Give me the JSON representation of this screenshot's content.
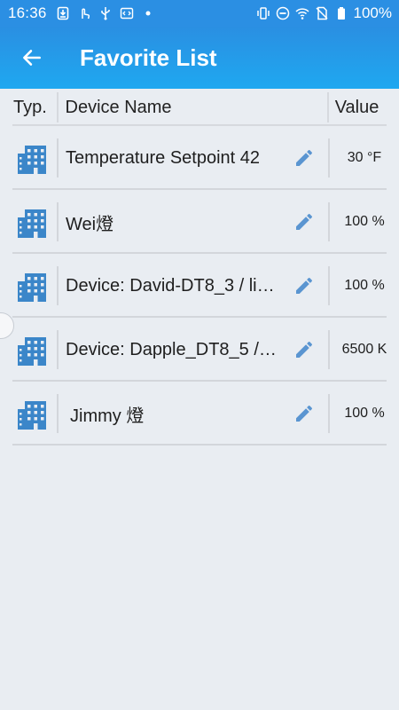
{
  "status_bar": {
    "time": "16:36",
    "battery": "100%",
    "icons_left": [
      "download-icon",
      "touch-icon",
      "usb-icon",
      "code-icon",
      "dot-icon"
    ],
    "icons_right": [
      "vibrate-icon",
      "dnd-icon",
      "wifi-icon",
      "no-sim-icon",
      "battery-icon"
    ]
  },
  "app_bar": {
    "title": "Favorite List",
    "back_icon": "arrow-left-icon"
  },
  "table": {
    "headers": {
      "type": "Typ.",
      "name": "Device Name",
      "value": "Value"
    },
    "rows": [
      {
        "icon": "building-icon",
        "name": "Temperature Setpoint 42",
        "value": "30 °F"
      },
      {
        "icon": "building-icon",
        "name": "Wei燈",
        "value": "100 %"
      },
      {
        "icon": "building-icon",
        "name": "Device: David-DT8_3 / lig…",
        "value": "100 %"
      },
      {
        "icon": "building-icon",
        "name": "Device: Dapple_DT8_5 / …",
        "value": "6500 K"
      },
      {
        "icon": "building-icon",
        "name": "Jimmy 燈",
        "value": "100 %"
      }
    ]
  },
  "colors": {
    "accent": "#2b8fe3",
    "icon_blue": "#3b86c9",
    "edit_blue": "#5a95d1",
    "background": "#e9edf2"
  }
}
